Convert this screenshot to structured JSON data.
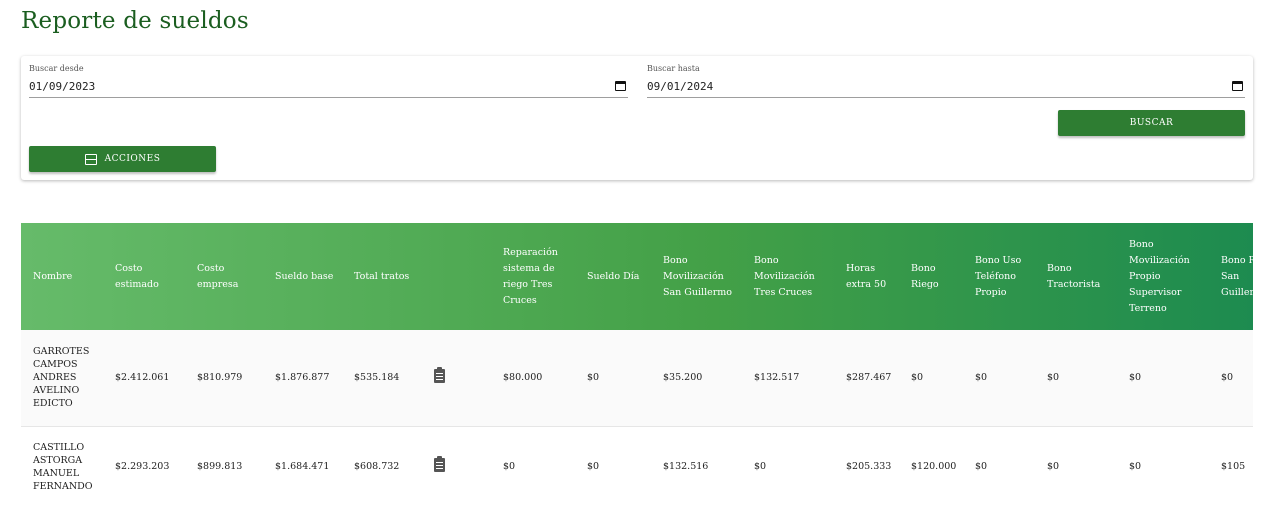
{
  "page": {
    "title": "Reporte de sueldos"
  },
  "filters": {
    "desde_label": "Buscar desde",
    "desde_value": "01/09/2023",
    "hasta_label": "Buscar hasta",
    "hasta_value": "09/01/2024",
    "buscar_label": "BUSCAR",
    "acciones_label": "ACCIONES",
    "icons": {
      "calendar": "calendar-icon",
      "acciones": "inbox-icon",
      "detail": "clipboard-icon"
    }
  },
  "table": {
    "columns": [
      "Nombre",
      "Costo estimado",
      "Costo empresa",
      "Sueldo base",
      "Total tratos",
      "",
      "Reparación sistema de riego Tres Cruces",
      "Sueldo Día",
      "Bono Movilización San Guillermo",
      "Bono Movilización Tres Cruces",
      "Horas extra 50",
      "Bono Riego",
      "Bono Uso Teléfono Propio",
      "Bono Tractorista",
      "Bono Movilización Propio Supervisor Terreno",
      "Bono Riego San Guillermo"
    ],
    "rows": [
      [
        "GARROTES CAMPOS ANDRES AVELINO EDICTO",
        "$2.412.061",
        "$810.979",
        "$1.876.877",
        "$535.184",
        "",
        "$80.000",
        "$0",
        "$35.200",
        "$132.517",
        "$287.467",
        "$0",
        "$0",
        "$0",
        "$0",
        "$0"
      ],
      [
        "CASTILLO ASTORGA MANUEL FERNANDO",
        "$2.293.203",
        "$899.813",
        "$1.684.471",
        "$608.732",
        "",
        "$0",
        "$0",
        "$132.516",
        "$0",
        "$205.333",
        "$120.000",
        "$0",
        "$0",
        "$0",
        "$105"
      ]
    ]
  },
  "colors": {
    "primary": "#2e7d32",
    "title": "#1b5e20",
    "header_start": "#66bb6a",
    "header_end": "#1b8a50"
  }
}
